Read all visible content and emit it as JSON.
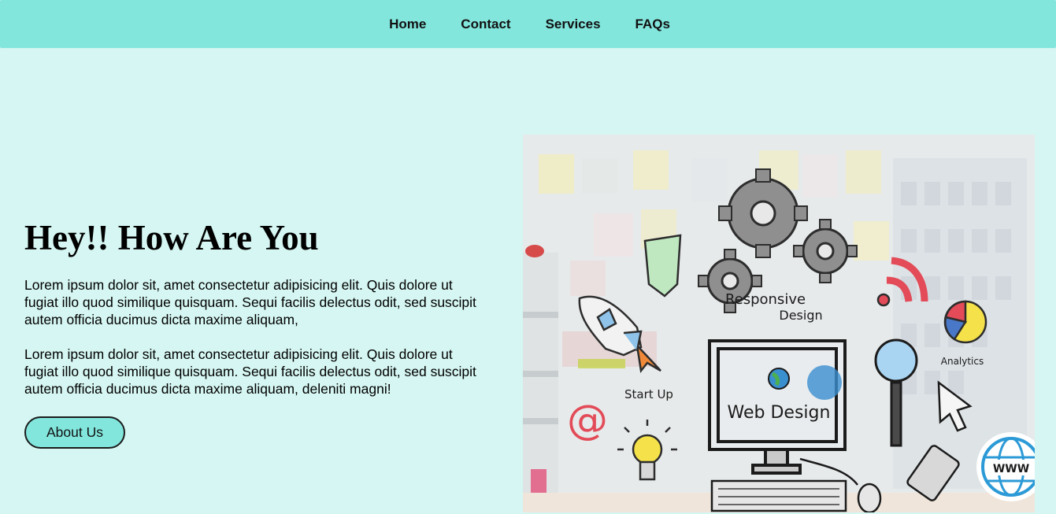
{
  "nav": {
    "items": [
      {
        "label": "Home"
      },
      {
        "label": "Contact"
      },
      {
        "label": "Services"
      },
      {
        "label": "FAQs"
      }
    ]
  },
  "hero": {
    "heading": "Hey!! How Are You",
    "paragraphs": [
      "Lorem ipsum dolor sit, amet consectetur adipisicing elit. Quis dolore ut fugiat illo quod similique quisquam. Sequi facilis delectus odit, sed suscipit autem officia ducimus dicta maxime aliquam,",
      "Lorem ipsum dolor sit, amet consectetur adipisicing elit. Quis dolore ut fugiat illo quod similique quisquam. Sequi facilis delectus odit, sed suscipit autem officia ducimus dicta maxime aliquam, deleniti magni!"
    ],
    "button_label": "About Us"
  },
  "illustration": {
    "labels": {
      "responsive": "Responsive",
      "design": "Design",
      "analytics": "Analytics",
      "start_up": "Start Up",
      "web_design": "Web Design",
      "www": "WWW"
    }
  },
  "colors": {
    "nav_bg": "#82e6dd",
    "page_bg": "#d5f6f2",
    "button_bg": "#82e6dd",
    "text": "#000000"
  }
}
